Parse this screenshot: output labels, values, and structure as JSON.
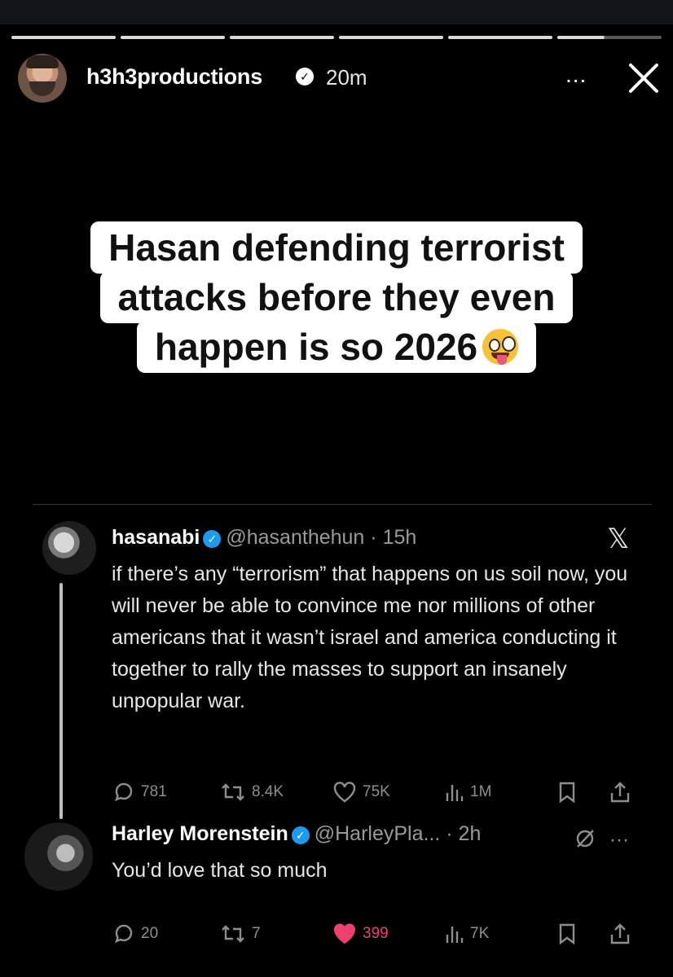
{
  "story": {
    "username": "h3h3productions",
    "time": "20m",
    "more_label": "...",
    "progress_segments": 6,
    "current_segment_fraction": 0.45
  },
  "caption": {
    "line1": "Hasan defending terrorist",
    "line2": "attacks before they even",
    "line3": "happen is so 2026",
    "emoji": "zany-face-emoji"
  },
  "tweet1": {
    "name": "hasanabi",
    "handle": "@hasanthehun",
    "time": "15h",
    "text": "if there’s any “terrorism” that happens on us soil now, you will never be able to convince me nor millions of other americans that it wasn’t israel and america conducting it together to rally the masses to support an insanely unpopular war.",
    "replies": "781",
    "retweets": "8.4K",
    "likes": "75K",
    "views": "1M"
  },
  "tweet2": {
    "name": "Harley Morenstein",
    "handle": "@HarleyPla...",
    "time": "2h",
    "text": "You’d love that so much",
    "replies": "20",
    "retweets": "7",
    "likes": "399",
    "views": "7K"
  },
  "colors": {
    "background": "#000000",
    "verified_blue": "#1d9bf0",
    "like_red": "#f0406f",
    "muted": "#8e8e8e"
  }
}
